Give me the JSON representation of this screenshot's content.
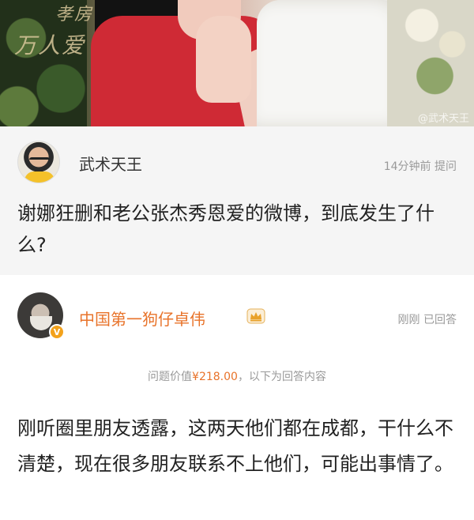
{
  "photo": {
    "sign_top": "孝房子",
    "sign_bottom": "万人爱",
    "watermark": "@武术天王"
  },
  "question": {
    "author": "武术天王",
    "time": "14分钟前",
    "action": "提问",
    "text": "谢娜狂删和老公张杰秀恩爱的微博，到底发生了什么?"
  },
  "answer": {
    "author": "中国第一狗仔卓伟",
    "verified_badge": "V",
    "time": "刚刚",
    "status": "已回答",
    "bounty_prefix": "问题价值",
    "bounty_price": "¥218.00",
    "bounty_suffix": "，以下为回答内容",
    "text": "刚听圈里朋友透露，这两天他们都在成都，干什么不清楚，现在很多朋友联系不上他们，可能出事情了。"
  },
  "colors": {
    "accent_orange": "#e8732a",
    "meta_gray": "#999999",
    "question_bg": "#f5f5f5"
  }
}
